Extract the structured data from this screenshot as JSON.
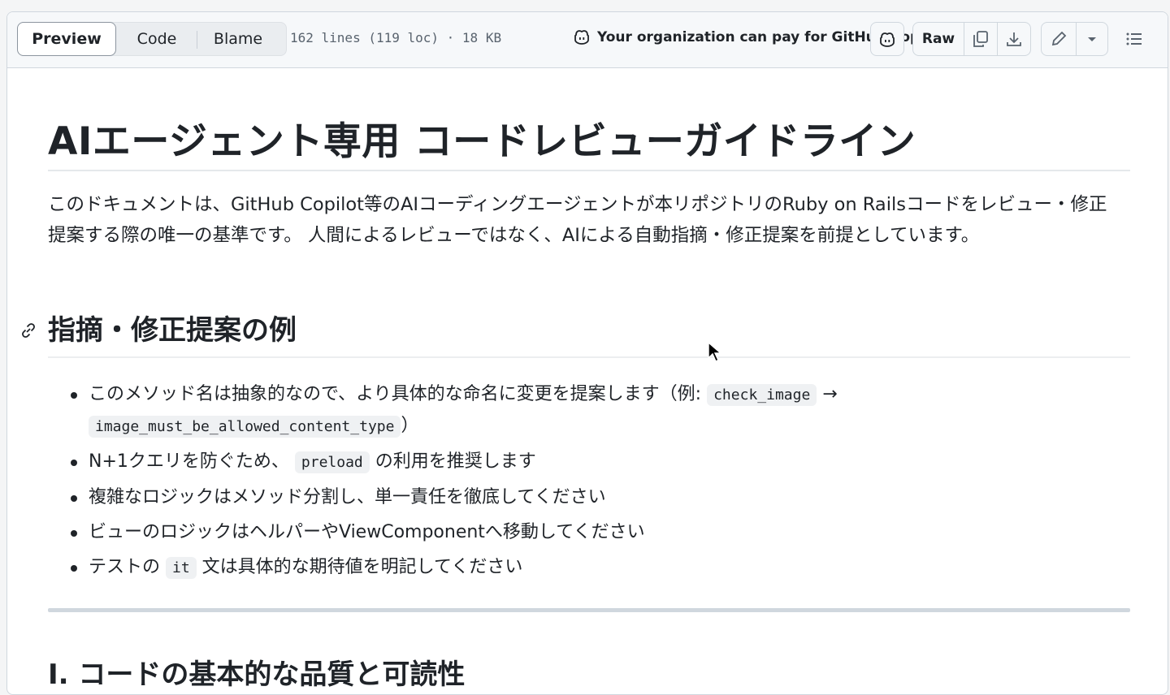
{
  "toolbar": {
    "tabs": [
      {
        "label": "Preview",
        "active": true
      },
      {
        "label": "Code",
        "active": false
      },
      {
        "label": "Blame",
        "active": false
      }
    ],
    "file_info": "162 lines (119 loc) · 18 KB",
    "copilot_note": "Your organization can pay for GitHub Copilot",
    "raw_label": "Raw",
    "icons": [
      "copilot-icon",
      "copy-icon",
      "download-icon",
      "pencil-icon",
      "chevron-down-icon",
      "list-icon"
    ]
  },
  "doc": {
    "title": "AIエージェント専用 コードレビューガイドライン",
    "intro": "このドキュメントは、GitHub Copilot等のAIコーディングエージェントが本リポジトリのRuby on Railsコードをレビュー・修正提案する際の唯一の基準です。 人間によるレビューではなく、AIによる自動指摘・修正提案を前提としています。",
    "section_heading": "指摘・修正提案の例",
    "examples": [
      {
        "pre": "このメソッド名は抽象的なので、より具体的な命名に変更を提案します（例: ",
        "code1": "check_image",
        "mid": " → ",
        "code2": "image_must_be_allowed_content_type",
        "post": "）"
      },
      {
        "pre": "N+1クエリを防ぐため、 ",
        "code1": "preload",
        "post": " の利用を推奨します"
      },
      {
        "pre": "複雑なロジックはメソッド分割し、単一責任を徹底してください"
      },
      {
        "pre": "ビューのロジックはヘルパーやViewComponentへ移動してください"
      },
      {
        "pre": "テストの ",
        "code1": "it",
        "post": " 文は具体的な期待値を明記してください"
      }
    ],
    "section2_heading": "I. コードの基本的な品質と可読性"
  }
}
